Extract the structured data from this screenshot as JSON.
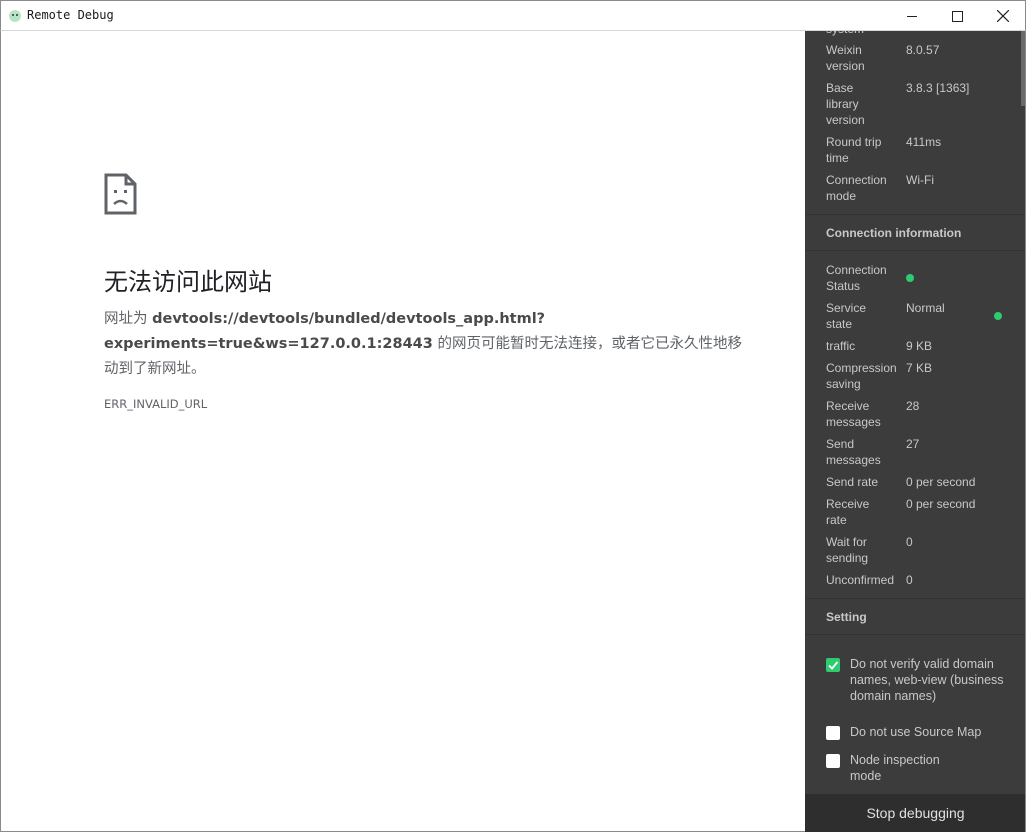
{
  "window": {
    "title": "Remote Debug"
  },
  "error_page": {
    "title": "无法访问此网站",
    "desc_prefix": "网址为 ",
    "url_line1": "devtools://devtools/bundled/devtools_app.html?",
    "url_line2": "experiments=true&ws=127.0.0.1:28443",
    "desc_suffix": " 的网页可能暂时无法连接，或者它已永久性地移",
    "desc_line3": "动到了新网址。",
    "code": "ERR_INVALID_URL"
  },
  "device_info": [
    {
      "key": "system",
      "value": ""
    },
    {
      "key": "Weixin version",
      "value": "8.0.57"
    },
    {
      "key": "Base library version",
      "value": "3.8.3 [1363]"
    },
    {
      "key": "Round trip time",
      "value": "411ms"
    },
    {
      "key": "Connection mode",
      "value": "Wi-Fi"
    }
  ],
  "connection_section": {
    "title": "Connection information"
  },
  "connection_info": [
    {
      "key": "Connection Status",
      "value": ""
    },
    {
      "key": "Service state",
      "value": "Normal"
    },
    {
      "key": "traffic",
      "value": "9 KB"
    },
    {
      "key": "Compression saving",
      "value": "7 KB"
    },
    {
      "key": "Receive messages",
      "value": "28"
    },
    {
      "key": "Send messages",
      "value": "27"
    },
    {
      "key": "Send rate",
      "value": "0 per second"
    },
    {
      "key": "Receive rate",
      "value": "0 per second"
    },
    {
      "key": "Wait for sending",
      "value": "0"
    },
    {
      "key": "Unconfirmed",
      "value": "0"
    }
  ],
  "settings_section": {
    "title": "Setting"
  },
  "settings": [
    {
      "label": "Do not verify valid domain names, web-view (business domain names)",
      "checked": true
    },
    {
      "label": "Do not use Source Map",
      "checked": false
    },
    {
      "label": "Node inspection mode",
      "checked": false
    }
  ],
  "stop_button": {
    "label": "Stop debugging"
  },
  "colors": {
    "panel_bg": "#3c3c3c",
    "accent_green": "#2ecc71",
    "stop_bg": "#2e2e2e"
  }
}
